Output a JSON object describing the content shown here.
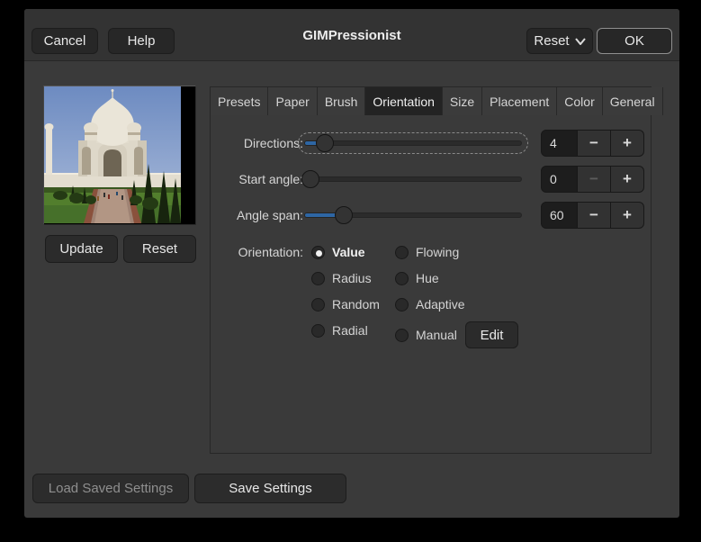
{
  "window": {
    "title": "GIMPressionist"
  },
  "titlebar": {
    "cancel_label": "Cancel",
    "help_label": "Help",
    "reset_label": "Reset",
    "ok_label": "OK"
  },
  "preview": {
    "image_description": "taj-mahal-photo-preview",
    "update_label": "Update",
    "reset_label": "Reset"
  },
  "tabs": {
    "labels": [
      "Presets",
      "Paper",
      "Brush",
      "Orientation",
      "Size",
      "Placement",
      "Color",
      "General"
    ],
    "active": "Orientation"
  },
  "orientation": {
    "directions": {
      "label": "Directions:",
      "value": "4"
    },
    "start_angle": {
      "label": "Start angle:",
      "value": "0"
    },
    "angle_span": {
      "label": "Angle span:",
      "value": "60"
    },
    "label": "Orientation:",
    "options": {
      "value": "Value",
      "radius": "Radius",
      "random": "Random",
      "radial": "Radial",
      "flowing": "Flowing",
      "hue": "Hue",
      "adaptive": "Adaptive",
      "manual": "Manual"
    },
    "selected_option": "Value",
    "edit_label": "Edit"
  },
  "footer": {
    "load_label": "Load Saved Settings",
    "save_label": "Save Settings"
  },
  "icons": {
    "minus": "−",
    "plus": "+"
  },
  "colors": {
    "accent_blue": "#2e66a4",
    "dialog_bg": "#3a3a3a",
    "header_bg": "#333333",
    "entry_bg": "#1d1d1d"
  }
}
